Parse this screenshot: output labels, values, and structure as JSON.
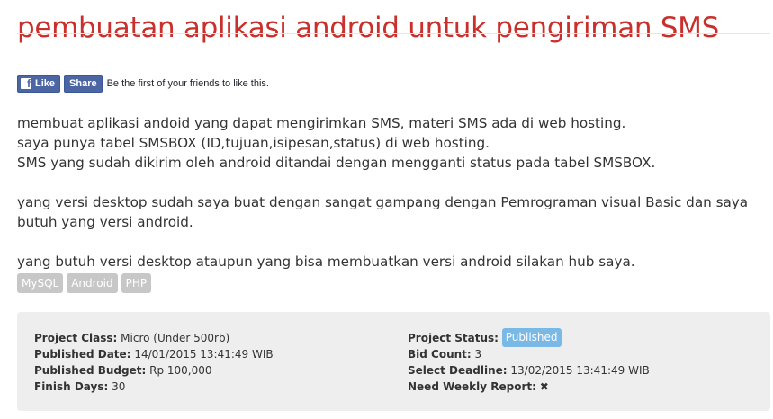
{
  "page": {
    "title": "pembuatan aplikasi android untuk pengiriman SMS"
  },
  "facebook": {
    "like_label": "Like",
    "share_label": "Share",
    "social_text": "Be the first of your friends to like this."
  },
  "description": {
    "line1": "membuat aplikasi andoid yang dapat mengirimkan SMS, materi SMS ada di web hosting.",
    "line2": "saya punya tabel SMSBOX (ID,tujuan,isipesan,status) di web hosting.",
    "line3": "SMS yang sudah dikirim oleh android ditandai dengan mengganti status pada tabel SMSBOX.",
    "para2": "yang versi desktop sudah saya buat dengan sangat gampang dengan Pemrograman visual Basic dan saya butuh yang versi android.",
    "para3": "yang butuh versi desktop ataupun yang bisa membuatkan versi android silakan hub saya."
  },
  "tags": [
    "MySQL",
    "Android",
    "PHP"
  ],
  "project": {
    "class_label": "Project Class:",
    "class_value": "Micro (Under 500rb)",
    "published_date_label": "Published Date:",
    "published_date_value": "14/01/2015 13:41:49 WIB",
    "budget_label": "Published Budget:",
    "budget_value": "Rp 100,000",
    "finish_days_label": "Finish Days:",
    "finish_days_value": "30",
    "status_label": "Project Status:",
    "status_value": "Published",
    "bid_count_label": "Bid Count:",
    "bid_count_value": "3",
    "deadline_label": "Select Deadline:",
    "deadline_value": "13/02/2015 13:41:49 WIB",
    "weekly_report_label": "Need Weekly Report:",
    "weekly_report_icon": "x-mark-icon"
  },
  "colors": {
    "title": "#c9302c",
    "facebook": "#4c66a4",
    "tag_bg": "#c7c7c7",
    "status_badge": "#7ab8e6",
    "info_bg": "#eeeeee"
  }
}
